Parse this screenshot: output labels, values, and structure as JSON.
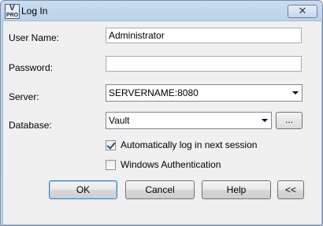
{
  "window": {
    "title": "Log In",
    "icon_text_top": "V",
    "icon_text_bottom": "PRO",
    "close_glyph": "✕"
  },
  "form": {
    "username_label": "User Name:",
    "username_value": "Administrator",
    "password_label": "Password:",
    "password_value": "",
    "server_label": "Server:",
    "server_value": "SERVERNAME:8080",
    "database_label": "Database:",
    "database_value": "Vault",
    "browse_label": "...",
    "auto_login_label": "Automatically log in next session",
    "auto_login_checked": true,
    "windows_auth_label": "Windows Authentication",
    "windows_auth_checked": false
  },
  "buttons": {
    "ok": "OK",
    "cancel": "Cancel",
    "help": "Help",
    "collapse": "<<"
  },
  "colors": {
    "title_gradient": "#c9dcf0",
    "dialog_bg": "#f0f0f0",
    "default_button_border": "#3c7fb1"
  }
}
